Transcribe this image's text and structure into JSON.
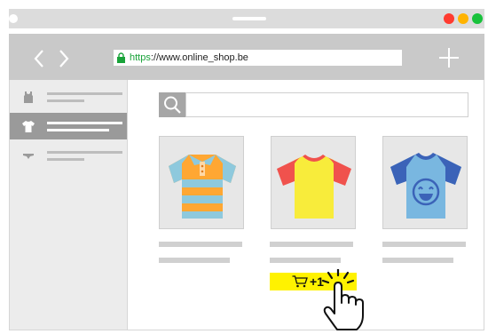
{
  "browser": {
    "url": {
      "protocol": "https",
      "rest": "://www.online_shop.be"
    },
    "icons": {
      "back": "chevron-left-icon",
      "forward": "chevron-right-icon",
      "lock": "lock-icon",
      "new_tab": "plus-icon"
    },
    "window_controls": {
      "close_color": "#ff3b30",
      "minimize_color": "#ffb300",
      "maximize_color": "#18c23b"
    }
  },
  "sidebar": {
    "items": [
      {
        "icon": "tank-top-icon",
        "active": false
      },
      {
        "icon": "tshirt-icon",
        "active": true
      },
      {
        "icon": "swimwear-icon",
        "active": false
      }
    ]
  },
  "search": {
    "icon": "search-icon",
    "value": ""
  },
  "products": [
    {
      "image": "striped-polo-shirt",
      "colors": [
        "#ffa733",
        "#8ec9dd"
      ]
    },
    {
      "image": "raglan-tshirt",
      "colors": [
        "#f8ec3b",
        "#f0524d"
      ]
    },
    {
      "image": "smiley-tshirt",
      "colors": [
        "#79b7e0",
        "#3b63b8"
      ]
    }
  ],
  "cart_button": {
    "icon": "cart-icon",
    "count_label": "+1",
    "color": "#fff200"
  },
  "pointer": {
    "icon": "hand-pointer-icon"
  }
}
